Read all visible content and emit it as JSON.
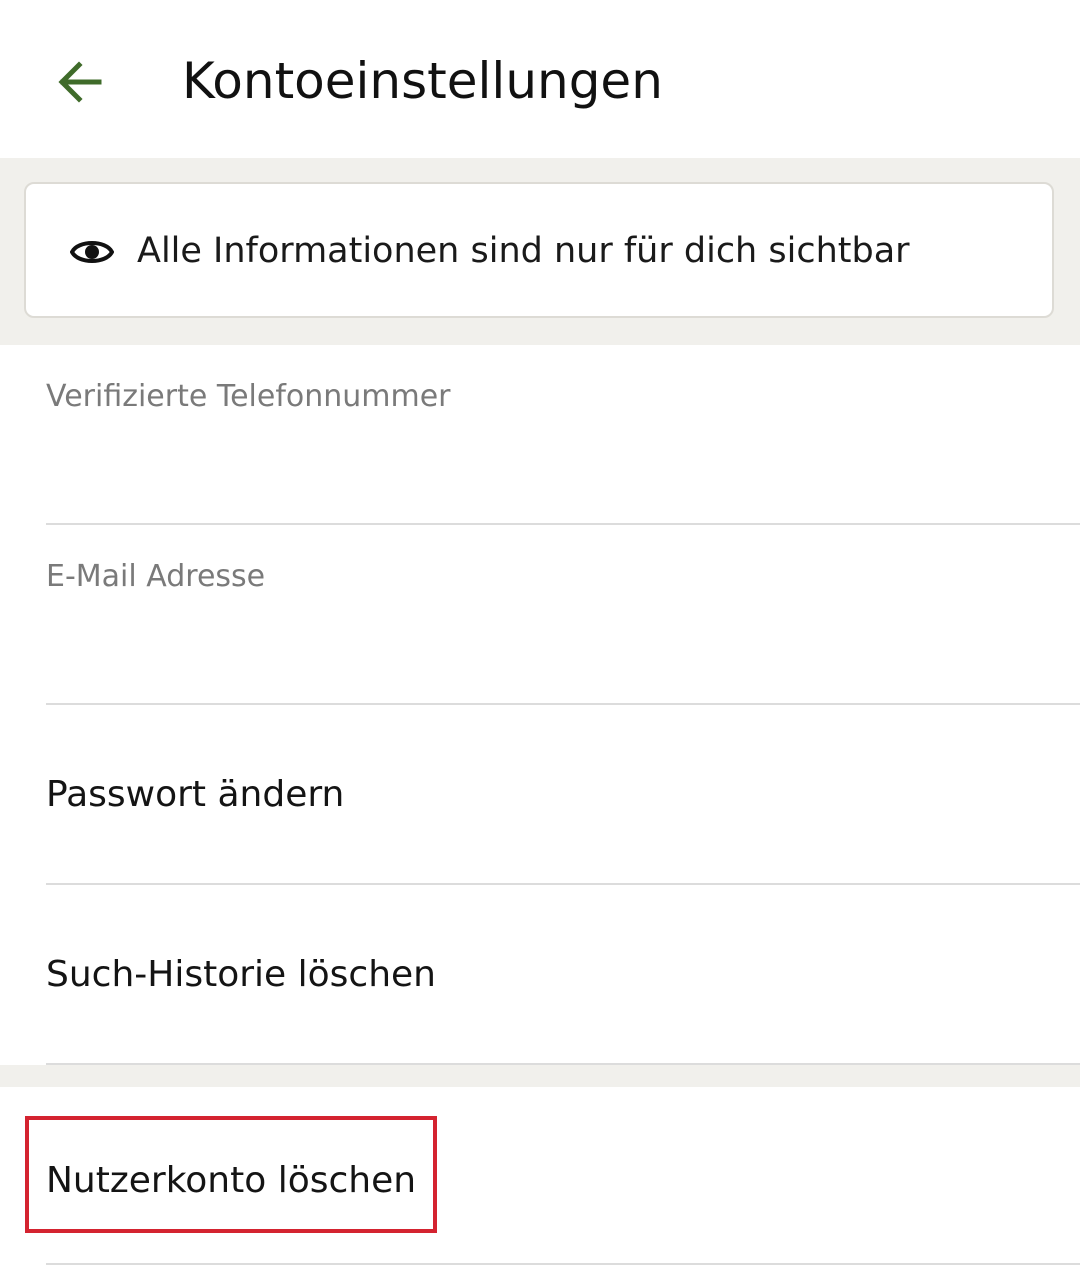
{
  "appbar": {
    "title": "Kontoeinstellungen",
    "back_icon": "arrow-left-icon",
    "accent_color": "#3f6b2a"
  },
  "info": {
    "icon": "eye-icon",
    "text": "Alle Informationen sind nur für dich sichtbar"
  },
  "fields": {
    "phone": {
      "label": "Verifizierte Telefonnummer",
      "value": ""
    },
    "email": {
      "label": "E-Mail Adresse",
      "value": ""
    }
  },
  "actions": {
    "change_password": "Passwort ändern",
    "clear_history": "Such-Historie löschen",
    "delete_account": "Nutzerkonto löschen"
  },
  "highlight": {
    "color": "#d42330",
    "target": "delete_account"
  }
}
